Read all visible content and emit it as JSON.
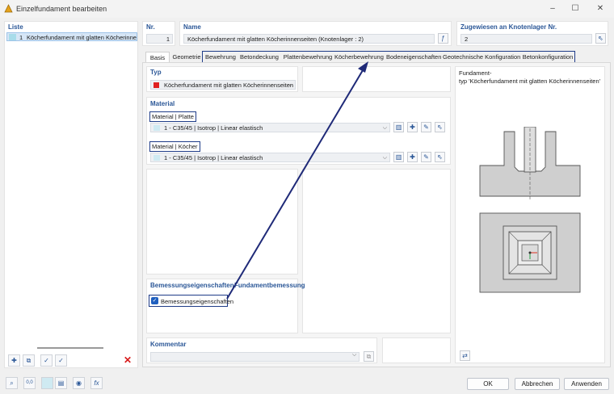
{
  "window": {
    "title": "Einzelfundament bearbeiten"
  },
  "list": {
    "header": "Liste",
    "items": [
      {
        "number": "1",
        "label": "Köcherfundament mit glatten Köcherinnenseiten"
      }
    ]
  },
  "nr": {
    "header": "Nr.",
    "value": "1"
  },
  "name": {
    "header": "Name",
    "value": "Köcherfundament mit glatten Köcherinnenseiten (Knotenlager : 2)"
  },
  "assigned": {
    "header": "Zugewiesen an Knotenlager Nr.",
    "value": "2"
  },
  "tabs": [
    "Basis",
    "Geometrie",
    "Bewehrung",
    "Betondeckung",
    "Plattenbewehrung",
    "Köcherbewehrung",
    "Bodeneigenschaften",
    "Geotechnische Konfiguration",
    "Betonkonfiguration"
  ],
  "typ": {
    "header": "Typ",
    "value": "Köcherfundament mit glatten Köcherinnenseiten",
    "color": "#e02020"
  },
  "material": {
    "header": "Material",
    "plate": {
      "label": "Material | Platte",
      "value": "1 - C35/45 | Isotrop | Linear elastisch"
    },
    "socket": {
      "label": "Material | Köcher",
      "value": "1 - C35/45 | Isotrop | Linear elastisch"
    }
  },
  "design": {
    "header_left": "Bemessungseigenschaften",
    "header_right": "Fundamentbemessung",
    "checkbox_label": "Bemessungseigenschaften",
    "checked": true
  },
  "comment": {
    "header": "Kommentar",
    "value": ""
  },
  "preview": {
    "line1": "Fundament-",
    "line2": "typ 'Köcherfundament mit glatten Köcherinnenseiten'"
  },
  "buttons": {
    "ok": "OK",
    "cancel": "Abbrechen",
    "apply": "Anwenden"
  },
  "accent_color": "#1f3c88"
}
